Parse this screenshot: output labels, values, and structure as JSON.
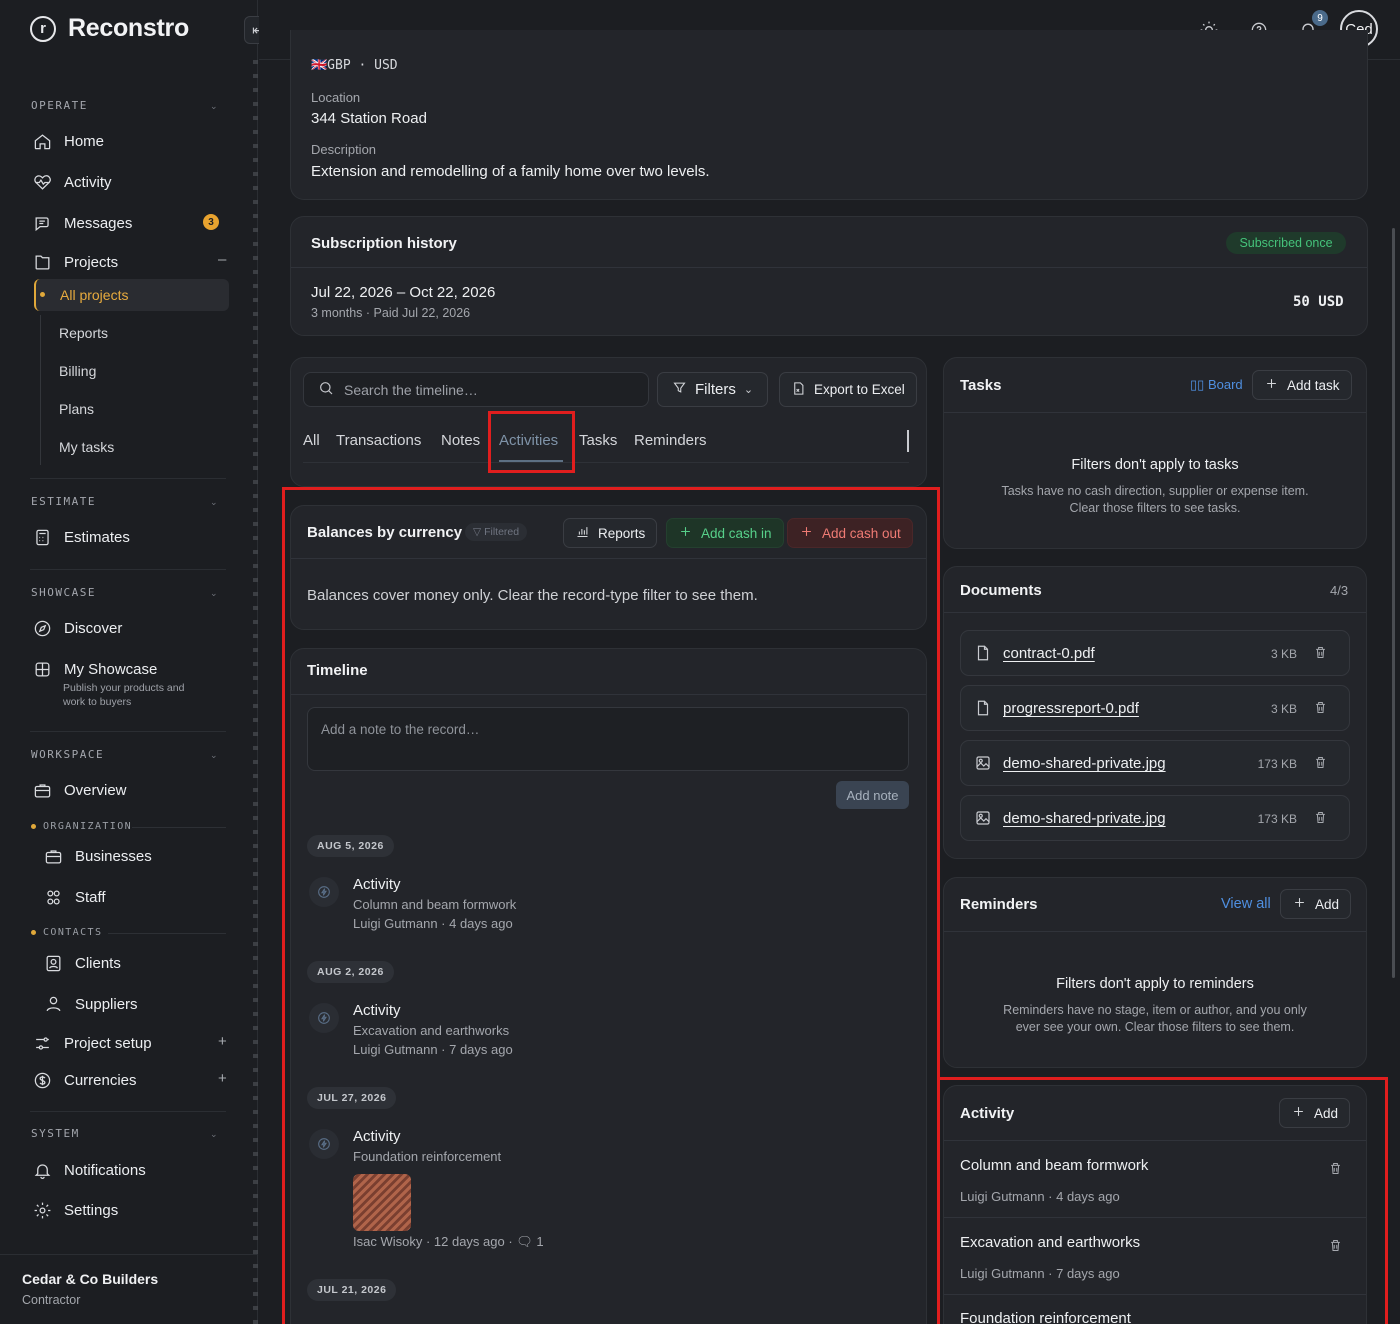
{
  "app": {
    "name": "Reconstro"
  },
  "sidebar": {
    "sections": {
      "operate": "OPERATE",
      "estimate": "ESTIMATE",
      "showcase": "SHOWCASE",
      "workspace": "WORKSPACE",
      "organization": "ORGANIZATION",
      "contacts": "CONTACTS",
      "system": "SYSTEM"
    },
    "items": {
      "home": "Home",
      "activity": "Activity",
      "messages": "Messages",
      "messages_badge": "3",
      "projects": "Projects",
      "all_projects": "All projects",
      "reports": "Reports",
      "billing": "Billing",
      "plans": "Plans",
      "my_tasks": "My tasks",
      "estimates": "Estimates",
      "discover": "Discover",
      "my_showcase": "My Showcase",
      "my_showcase_sub1": "Publish your products and",
      "my_showcase_sub2": "work to buyers",
      "overview": "Overview",
      "businesses": "Businesses",
      "staff": "Staff",
      "clients": "Clients",
      "suppliers": "Suppliers",
      "project_setup": "Project setup",
      "currencies": "Currencies",
      "notifications": "Notifications",
      "settings": "Settings"
    },
    "footer": {
      "company": "Cedar & Co Builders",
      "role": "Contractor"
    }
  },
  "topbar": {
    "notif_count": "9",
    "avatar_text": "Ced"
  },
  "project": {
    "currency_line": "🇬🇧GBP · USD",
    "location_label": "Location",
    "location": "344 Station Road",
    "description_label": "Description",
    "description": "Extension and remodelling of a family home over two levels."
  },
  "subscription": {
    "title": "Subscription history",
    "status": "Subscribed once",
    "period": "Jul 22, 2026 – Oct 22, 2026",
    "detail": "3 months · Paid Jul 22, 2026",
    "amount": "50 USD"
  },
  "timeline_controls": {
    "search_placeholder": "Search the timeline…",
    "filters": "Filters",
    "export": "Export to Excel",
    "tabs": [
      "All",
      "Transactions",
      "Notes",
      "Activities",
      "Tasks",
      "Reminders"
    ],
    "active_tab": "Activities"
  },
  "balances": {
    "title": "Balances by currency",
    "filtered": "Filtered",
    "reports_btn": "Reports",
    "add_in": "Add cash in",
    "add_out": "Add cash out",
    "message": "Balances cover money only. Clear the record-type filter to see them."
  },
  "timeline": {
    "title": "Timeline",
    "note_placeholder": "Add a note to the record…",
    "add_note": "Add note",
    "entries": [
      {
        "date": "AUG 5, 2026",
        "title": "Activity",
        "desc": "Column and beam formwork",
        "meta": "Luigi Gutmann · 4 days ago"
      },
      {
        "date": "AUG 2, 2026",
        "title": "Activity",
        "desc": "Excavation and earthworks",
        "meta": "Luigi Gutmann · 7 days ago"
      },
      {
        "date": "JUL 27, 2026",
        "title": "Activity",
        "desc": "Foundation reinforcement",
        "meta": "Isac Wisoky · 12 days ago · ",
        "comments": "1"
      },
      {
        "date": "JUL 21, 2026"
      }
    ]
  },
  "tasks": {
    "title": "Tasks",
    "board": "Board",
    "add": "Add task",
    "empty_title": "Filters don't apply to tasks",
    "empty_line1": "Tasks have no cash direction, supplier or expense item.",
    "empty_line2": "Clear those filters to see tasks."
  },
  "documents": {
    "title": "Documents",
    "count": "4/3",
    "files": [
      {
        "name": "contract-0.pdf",
        "size": "3 KB",
        "icon": "file-icon"
      },
      {
        "name": "progressreport-0.pdf",
        "size": "3 KB",
        "icon": "file-icon"
      },
      {
        "name": "demo-shared-private.jpg",
        "size": "173 KB",
        "icon": "image-icon"
      },
      {
        "name": "demo-shared-private.jpg",
        "size": "173 KB",
        "icon": "image-icon"
      }
    ]
  },
  "reminders": {
    "title": "Reminders",
    "view_all": "View all",
    "add": "Add",
    "empty_title": "Filters don't apply to reminders",
    "empty_line1": "Reminders have no stage, item or author, and you only",
    "empty_line2": "ever see your own. Clear those filters to see them."
  },
  "activity_panel": {
    "title": "Activity",
    "add": "Add",
    "items": [
      {
        "title": "Column and beam formwork",
        "meta": "Luigi Gutmann · 4 days ago"
      },
      {
        "title": "Excavation and earthworks",
        "meta": "Luigi Gutmann · 7 days ago"
      },
      {
        "title": "Foundation reinforcement"
      }
    ]
  },
  "colors": {
    "accent": "#e0a83a",
    "link": "#4f8fe0",
    "highlight": "#e01e1e",
    "success": "#45c27a",
    "danger": "#ef7b74"
  }
}
